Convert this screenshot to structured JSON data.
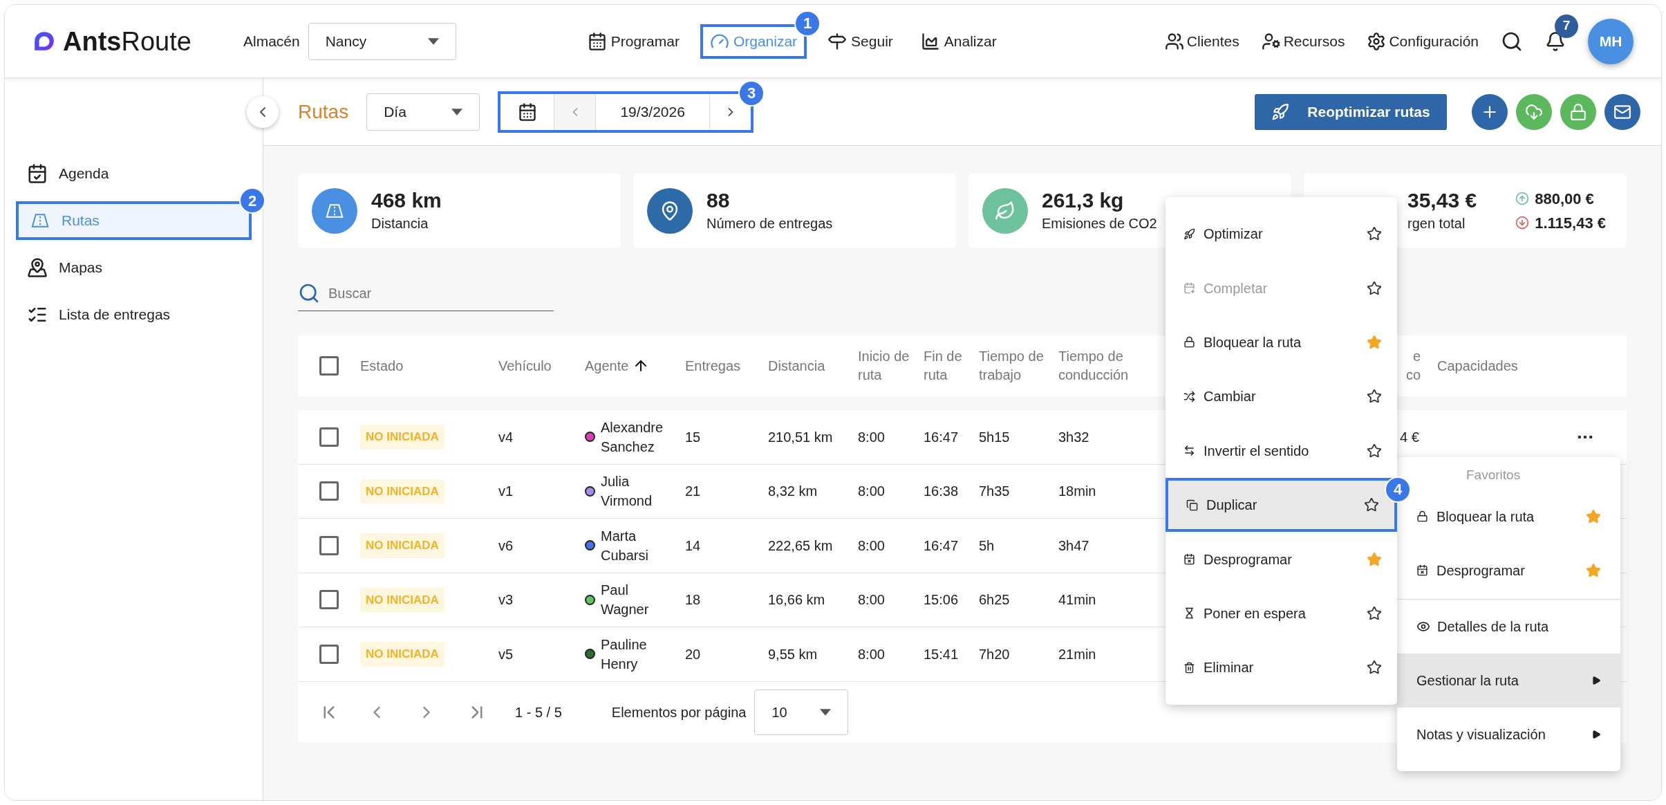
{
  "logo": {
    "text": "**Ants**Route"
  },
  "warehouse": {
    "label": "Almacén",
    "value": "Nancy"
  },
  "nav": [
    {
      "label": "Programar",
      "kind": "calendar",
      "selected": false
    },
    {
      "label": "Organizar",
      "kind": "gauge",
      "selected": true,
      "callout": "1"
    },
    {
      "label": "Seguir",
      "kind": "sign",
      "selected": false
    },
    {
      "label": "Analizar",
      "kind": "chart",
      "selected": false
    }
  ],
  "tools": [
    {
      "label": "Clientes",
      "kind": "clients"
    },
    {
      "label": "Recursos",
      "kind": "resources"
    },
    {
      "label": "Configuración",
      "kind": "settings"
    }
  ],
  "notifications": {
    "count": "7"
  },
  "user": {
    "initials": "MH"
  },
  "sidebar": {
    "items": [
      {
        "label": "Agenda",
        "kind": "agenda",
        "selected": false
      },
      {
        "label": "Rutas",
        "kind": "routes",
        "selected": true,
        "callout": "2"
      },
      {
        "label": "Mapas",
        "kind": "map",
        "selected": false
      },
      {
        "label": "Lista de entregas",
        "kind": "list",
        "selected": false
      }
    ]
  },
  "toolbar": {
    "title": "Rutas",
    "period": "Día",
    "date": "19/3/2026",
    "date_callout": "3",
    "primary_button": "Reoptimizar rutas",
    "actions": [
      {
        "kind": "add",
        "color": "#2f66a8"
      },
      {
        "kind": "download",
        "color": "#5cb85c"
      },
      {
        "kind": "lock",
        "color": "#5cb85c"
      },
      {
        "kind": "mail",
        "color": "#2f66a8"
      }
    ]
  },
  "kpis": [
    {
      "kind": "road",
      "value": "468 km",
      "label": "Distancia",
      "color": "#4a90e2"
    },
    {
      "kind": "pin",
      "value": "88",
      "label": "Número de entregas",
      "color": "#2d6aa8"
    },
    {
      "kind": "leaf",
      "value": "261,3 kg",
      "label": "Emisiones de CO2",
      "color": "#6dc19d"
    },
    {
      "kind": "margin",
      "value": "35,43 €",
      "label": "rgen total",
      "up": "880,00 €",
      "down": "1.115,43 €"
    }
  ],
  "search": {
    "placeholder": "Buscar"
  },
  "table": {
    "checked": false,
    "columns": [
      {
        "label": "Estado"
      },
      {
        "label": "Vehículo"
      },
      {
        "label": "Agente",
        "sorted": true
      },
      {
        "label": "Entregas"
      },
      {
        "label": "Distancia"
      },
      {
        "label": "Inicio de ruta"
      },
      {
        "label": "Fin de ruta"
      },
      {
        "label": "Tiempo de trabajo"
      },
      {
        "label": "Tiempo de conducción"
      },
      {
        "label": "e co"
      },
      {
        "label": "Capacidades"
      }
    ],
    "rows": [
      {
        "checked": false,
        "status": "NO INICIADA",
        "vehicle": "v4",
        "agent": "Alexandre Sanchez",
        "color": "#d63fb6",
        "deliveries": "15",
        "distance": "210,51 km",
        "start": "8:00",
        "end": "16:47",
        "work": "5h15",
        "driving": "3h32",
        "column_10": "4 €",
        "more": true
      },
      {
        "checked": false,
        "status": "NO INICIADA",
        "vehicle": "v1",
        "agent": "Julia Virmond",
        "color": "#a78be8",
        "deliveries": "21",
        "distance": "8,32 km",
        "start": "8:00",
        "end": "16:38",
        "work": "7h35",
        "driving": "18min"
      },
      {
        "checked": false,
        "status": "NO INICIADA",
        "vehicle": "v6",
        "agent": "Marta Cubarsi",
        "color": "#4a6fe0",
        "deliveries": "14",
        "distance": "222,65 km",
        "start": "8:00",
        "end": "16:47",
        "work": "5h",
        "driving": "3h47"
      },
      {
        "checked": false,
        "status": "NO INICIADA",
        "vehicle": "v3",
        "agent": "Paul Wagner",
        "color": "#5cc462",
        "deliveries": "18",
        "distance": "16,66 km",
        "start": "8:00",
        "end": "15:06",
        "work": "6h25",
        "driving": "41min"
      },
      {
        "checked": false,
        "status": "NO INICIADA",
        "vehicle": "v5",
        "agent": "Pauline Henry",
        "color": "#2e6b35",
        "deliveries": "20",
        "distance": "9,55 km",
        "start": "8:00",
        "end": "15:41",
        "work": "7h20",
        "driving": "21min"
      }
    ]
  },
  "pagination": {
    "range": "1 - 5 / 5",
    "per_page_label": "Elementos por página",
    "per_page": "10"
  },
  "actions_menu": {
    "items": [
      {
        "label": "Optimizar",
        "kind": "rocket",
        "disabled": false,
        "favorite": false,
        "selected": false
      },
      {
        "label": "Completar",
        "kind": "complete",
        "disabled": true,
        "favorite": false,
        "selected": false
      },
      {
        "label": "Bloquear la ruta",
        "kind": "lock",
        "disabled": false,
        "favorite": true,
        "selected": false
      },
      {
        "label": "Cambiar",
        "kind": "shuffle",
        "disabled": false,
        "favorite": false,
        "selected": false
      },
      {
        "label": "Invertir el sentido",
        "kind": "reverse",
        "disabled": false,
        "favorite": false,
        "selected": false
      },
      {
        "label": "Duplicar",
        "kind": "copy",
        "disabled": false,
        "favorite": false,
        "selected": true,
        "callout": "4"
      },
      {
        "label": "Desprogramar",
        "kind": "unschedule",
        "disabled": false,
        "favorite": true,
        "selected": false
      },
      {
        "label": "Poner en espera",
        "kind": "wait",
        "disabled": false,
        "favorite": false,
        "selected": false
      },
      {
        "label": "Eliminar",
        "kind": "delete",
        "disabled": false,
        "favorite": false,
        "selected": false
      }
    ]
  },
  "context_menu": {
    "section": "Favoritos",
    "favorites": [
      {
        "label": "Bloquear la ruta",
        "kind": "lock",
        "favorite": true
      },
      {
        "label": "Desprogramar",
        "kind": "unschedule",
        "favorite": true
      }
    ],
    "items": [
      {
        "label": "Detalles de la ruta",
        "kind": "eye",
        "submenu": false,
        "selected": false
      },
      {
        "label": "Gestionar la ruta",
        "kind": "none",
        "submenu": true,
        "selected": true
      },
      {
        "label": "Notas y visualización",
        "kind": "none",
        "submenu": true,
        "selected": false
      }
    ]
  }
}
